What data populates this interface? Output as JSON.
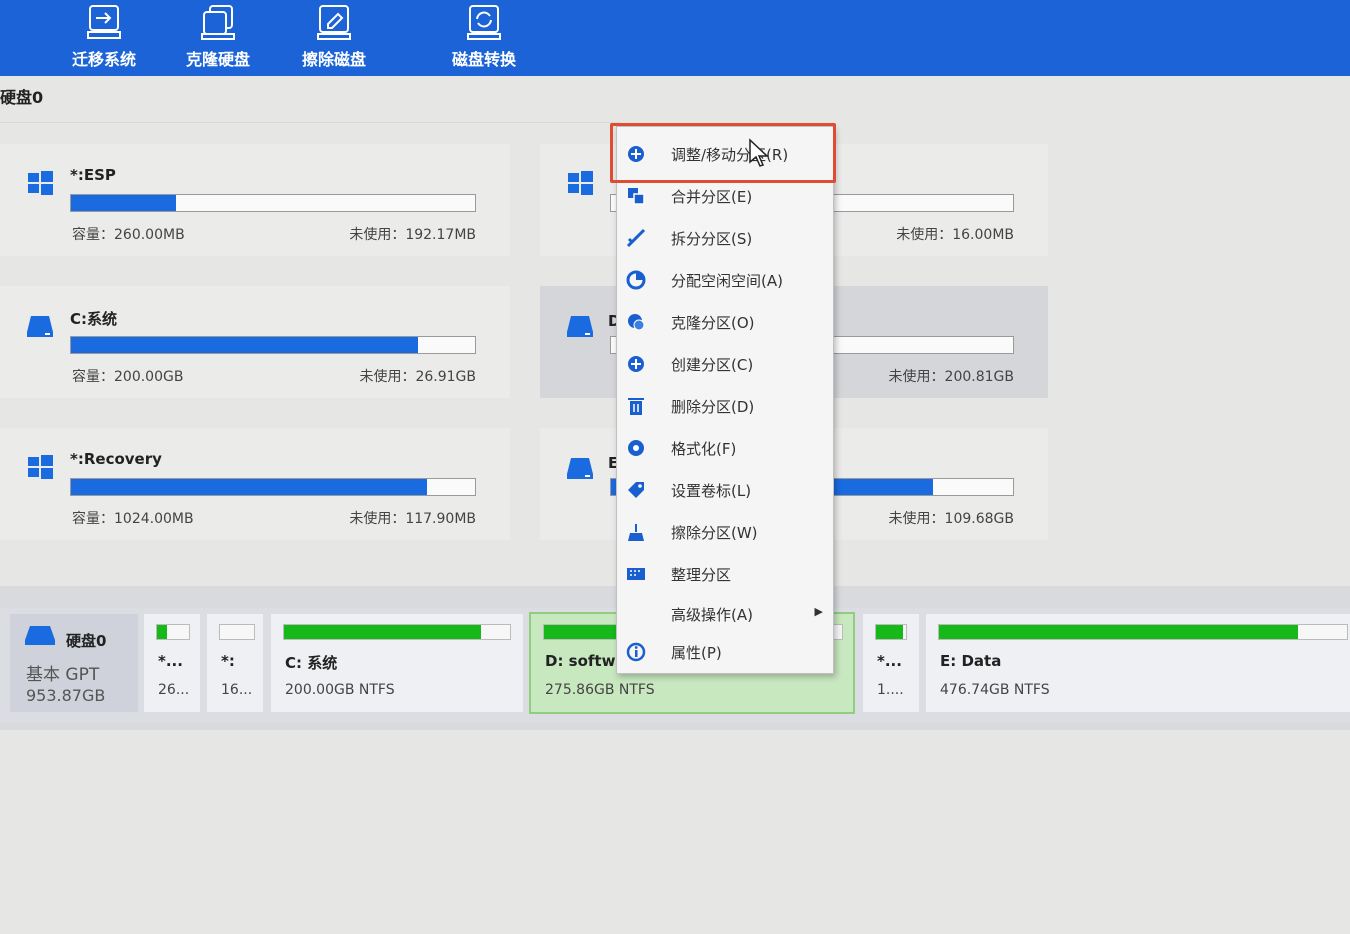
{
  "toolbar": {
    "buttons": [
      {
        "label": "迁移系统",
        "icon": "migrate-system-icon"
      },
      {
        "label": "克隆硬盘",
        "icon": "clone-disk-icon"
      },
      {
        "label": "擦除磁盘",
        "icon": "wipe-disk-icon"
      },
      {
        "label": "磁盘转换",
        "icon": "disk-convert-icon"
      }
    ]
  },
  "disk_header": "硬盘0",
  "partitions_left": [
    {
      "name": "*:ESP",
      "capacity": "容量：260.00MB",
      "free": "未使用：192.17MB",
      "used_pct": 26,
      "icon": "windows-icon"
    },
    {
      "name": "C:系统",
      "capacity": "容量：200.00GB",
      "free": "未使用：26.91GB",
      "used_pct": 86,
      "icon": "drive-icon"
    },
    {
      "name": "*:Recovery",
      "capacity": "容量：1024.00MB",
      "free": "未使用：117.90MB",
      "used_pct": 88,
      "icon": "windows-icon"
    }
  ],
  "partitions_right": [
    {
      "name": "",
      "free": "未使用：16.00MB",
      "used_pct": 0,
      "icon": "windows-icon"
    },
    {
      "name": "D",
      "free": "未使用：200.81GB",
      "used_pct": 0,
      "icon": "drive-icon"
    },
    {
      "name": "E",
      "free": "未使用：109.68GB",
      "used_pct": 80,
      "icon": "drive-icon"
    }
  ],
  "disk_map": {
    "summary": {
      "name": "硬盘0",
      "type": "基本 GPT",
      "size": "953.87GB"
    },
    "items": [
      {
        "name": "*...",
        "info": "26...",
        "used_pct": 30
      },
      {
        "name": "*:",
        "info": "16...",
        "used_pct": 0
      },
      {
        "name": "C: 系统",
        "info": "200.00GB NTFS",
        "used_pct": 87
      },
      {
        "name": "D: softw",
        "info": "275.86GB NTFS",
        "used_pct": 27
      },
      {
        "name": "*...",
        "info": "1....",
        "used_pct": 90
      },
      {
        "name": "E: Data",
        "info": "476.74GB NTFS",
        "used_pct": 88
      }
    ]
  },
  "context_menu": {
    "items": [
      {
        "label": "调整/移动分区(R)",
        "icon": "resize-move-icon"
      },
      {
        "label": "合并分区(E)",
        "icon": "merge-icon"
      },
      {
        "label": "拆分分区(S)",
        "icon": "split-icon"
      },
      {
        "label": "分配空闲空间(A)",
        "icon": "allocate-space-icon"
      },
      {
        "label": "克隆分区(O)",
        "icon": "clone-partition-icon"
      },
      {
        "label": "创建分区(C)",
        "icon": "create-partition-icon"
      },
      {
        "label": "删除分区(D)",
        "icon": "delete-icon"
      },
      {
        "label": "格式化(F)",
        "icon": "format-icon"
      },
      {
        "label": "设置卷标(L)",
        "icon": "label-tag-icon"
      },
      {
        "label": "擦除分区(W)",
        "icon": "wipe-partition-icon"
      },
      {
        "label": "整理分区",
        "icon": "defrag-icon"
      },
      {
        "label": "高级操作(A)",
        "icon": "",
        "submenu": true
      },
      {
        "label": "属性(P)",
        "icon": "info-icon"
      }
    ]
  },
  "colors": {
    "toolbar": "#1b63d6",
    "bar_blue": "#1a6ae0",
    "bar_green": "#16b81a",
    "highlight": "#e04b33"
  }
}
